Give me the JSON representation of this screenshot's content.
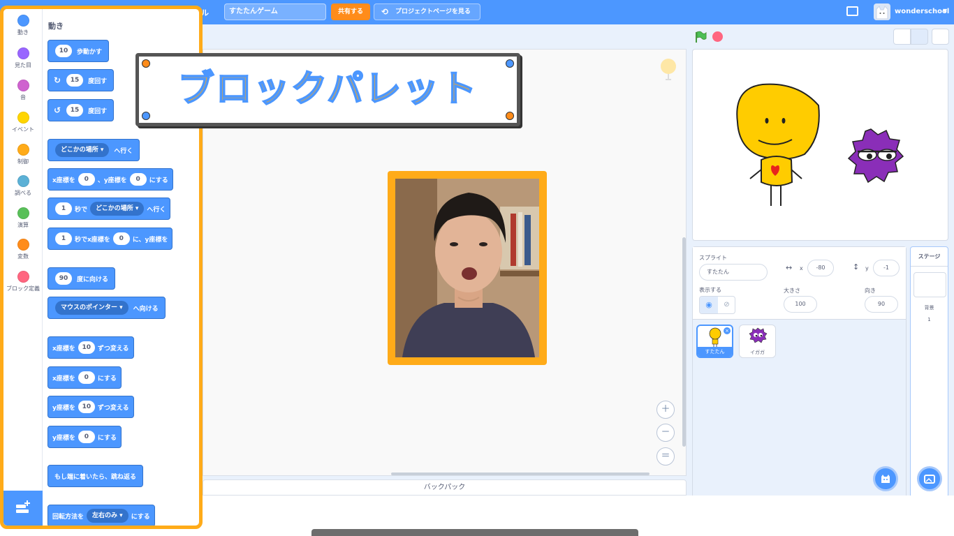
{
  "menubar": {
    "file_fragment": "ル",
    "project_title": "すたたんゲーム",
    "share_label": "共有する",
    "project_page_label": "プロジェクトページを見る",
    "username": "wonderschool"
  },
  "palette": {
    "categories": [
      {
        "label": "動き",
        "color": "#4c97ff"
      },
      {
        "label": "見た目",
        "color": "#9966ff"
      },
      {
        "label": "音",
        "color": "#cf63cf"
      },
      {
        "label": "イベント",
        "color": "#ffd500"
      },
      {
        "label": "制御",
        "color": "#ffab19"
      },
      {
        "label": "調べる",
        "color": "#5cb1d6"
      },
      {
        "label": "演算",
        "color": "#59c059"
      },
      {
        "label": "変数",
        "color": "#ff8c1a"
      },
      {
        "label": "ブロック定義",
        "color": "#ff6680"
      }
    ],
    "section_title": "動き",
    "blocks": {
      "move": {
        "value": "10",
        "text": "歩動かす"
      },
      "turn_right": {
        "value": "15",
        "text": "度回す"
      },
      "turn_left": {
        "value": "15",
        "text": "度回す"
      },
      "goto": {
        "menu": "どこかの場所",
        "text": "へ行く"
      },
      "goto_xy": {
        "t1": "x座標を",
        "x": "0",
        "t2": "、y座標を",
        "y": "0",
        "t3": "にする"
      },
      "glide": {
        "secs": "1",
        "t1": "秒で",
        "menu": "どこかの場所",
        "t2": "へ行く"
      },
      "glide_xy": {
        "secs": "1",
        "t1": "秒でx座標を",
        "x": "0",
        "t2": "に、y座標を"
      },
      "point_dir": {
        "value": "90",
        "text": "度に向ける"
      },
      "point_towards": {
        "menu": "マウスのポインター",
        "text": "へ向ける"
      },
      "change_x": {
        "t1": "x座標を",
        "value": "10",
        "t2": "ずつ変える"
      },
      "set_x": {
        "t1": "x座標を",
        "value": "0",
        "t2": "にする"
      },
      "change_y": {
        "t1": "y座標を",
        "value": "10",
        "t2": "ずつ変える"
      },
      "set_y": {
        "t1": "y座標を",
        "value": "0",
        "t2": "にする"
      },
      "bounce": {
        "text": "もし端に着いたら、跳ね返る"
      },
      "rotation_style": {
        "t1": "回転方法を",
        "menu": "左右のみ",
        "t2": "にする"
      }
    }
  },
  "overlay": {
    "banner_text": "ブロックパレット"
  },
  "backpack_label": "バックパック",
  "sprite_info": {
    "sprite_label": "スプライト",
    "sprite_name": "すたたん",
    "x_label": "x",
    "x_value": "-80",
    "y_label": "y",
    "y_value": "-1",
    "show_label": "表示する",
    "size_label": "大きさ",
    "size_value": "100",
    "direction_label": "向き",
    "direction_value": "90"
  },
  "sprites": [
    {
      "name": "すたたん",
      "selected": true
    },
    {
      "name": "イガガ",
      "selected": false
    }
  ],
  "stage_pane": {
    "title": "ステージ",
    "backdrop_label": "背景",
    "backdrop_count": "1"
  },
  "colors": {
    "scratch_blue": "#4c97ff",
    "highlight_orange": "#ffab19",
    "sprite_yellow": "#ffcc00",
    "monster_purple": "#8a2eb8"
  }
}
